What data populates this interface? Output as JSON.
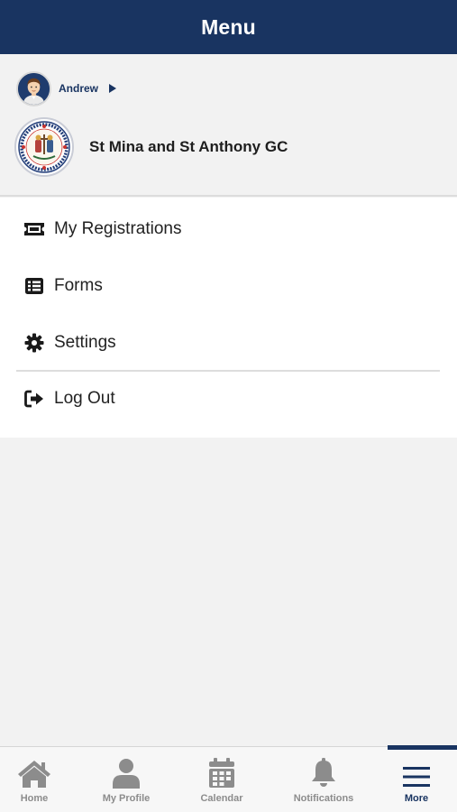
{
  "header": {
    "title": "Menu"
  },
  "account": {
    "user_name": "Andrew",
    "org_name": "St Mina and St Anthony GC"
  },
  "menu": {
    "items": [
      {
        "label": "My Registrations",
        "icon": "ticket-icon"
      },
      {
        "label": "Forms",
        "icon": "list-icon"
      },
      {
        "label": "Settings",
        "icon": "gear-icon"
      },
      {
        "label": "Log Out",
        "icon": "sign-out-icon"
      }
    ]
  },
  "tabs": [
    {
      "label": "Home",
      "icon": "home-icon",
      "active": false
    },
    {
      "label": "My Profile",
      "icon": "user-icon",
      "active": false
    },
    {
      "label": "Calendar",
      "icon": "calendar-icon",
      "active": false
    },
    {
      "label": "Notifications",
      "icon": "bell-icon",
      "active": false
    },
    {
      "label": "More",
      "icon": "hamburger-icon",
      "active": true
    }
  ],
  "colors": {
    "brand_navy": "#193461",
    "inactive_tab": "#8c8c8c",
    "background": "#f2f2f2"
  }
}
